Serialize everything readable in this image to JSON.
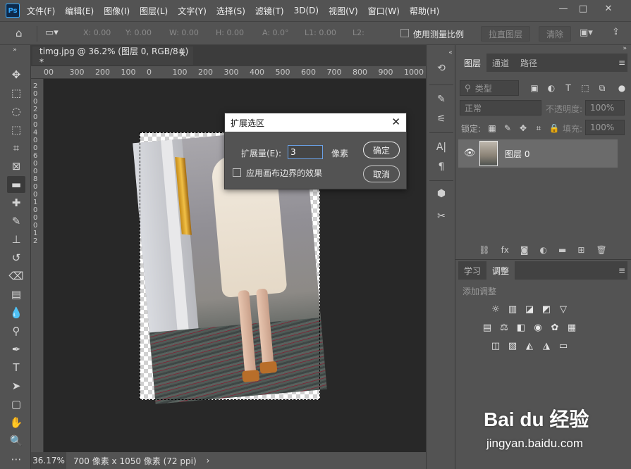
{
  "app": {
    "logo_text": "Ps"
  },
  "menu": [
    "文件(F)",
    "编辑(E)",
    "图像(I)",
    "图层(L)",
    "文字(Y)",
    "选择(S)",
    "滤镜(T)",
    "3D(D)",
    "视图(V)",
    "窗口(W)",
    "帮助(H)"
  ],
  "window_controls": {
    "minimize": "—",
    "maximize": "□",
    "close": "✕"
  },
  "options": {
    "x": "X: 0.00",
    "y": "Y: 0.00",
    "w": "W: 0.00",
    "h": "H: 0.00",
    "angle": "A: 0.0°",
    "l1": "L1: 0.00",
    "l2": "L2:",
    "use_scale_label": "使用测量比例",
    "straighten_label": "拉直图层",
    "clear_label": "清除"
  },
  "document": {
    "tab_title": "timg.jpg @ 36.2% (图层 0, RGB/8#) *",
    "ruler_h": [
      "00",
      "300",
      "200",
      "100",
      "0",
      "100",
      "200",
      "300",
      "400",
      "500",
      "600",
      "700",
      "800",
      "900",
      "1000"
    ],
    "ruler_v": [
      "2",
      "0",
      "0",
      "2",
      "0",
      "0",
      "4",
      "0",
      "0",
      "6",
      "0",
      "0",
      "8",
      "0",
      "0",
      "1",
      "0",
      "0",
      "0",
      "1",
      "2"
    ],
    "zoom": "36.17%",
    "size_info": "700 像素 x 1050 像素 (72 ppi)",
    "status_arrow": "›"
  },
  "dialog": {
    "title": "扩展选区",
    "expand_label": "扩展量(E):",
    "expand_value": "3",
    "unit": "像素",
    "ok_label": "确定",
    "cancel_label": "取消",
    "canvas_effect_label": "应用画布边界的效果"
  },
  "layers_panel": {
    "tabs": [
      "图层",
      "通道",
      "路径"
    ],
    "filter_placeholder": "类型",
    "blend_mode": "正常",
    "opacity_label": "不透明度:",
    "opacity_value": "100%",
    "lock_label": "锁定:",
    "fill_label": "填充:",
    "fill_value": "100%",
    "layer_name": "图层 0"
  },
  "adjustments_panel": {
    "tabs": [
      "学习",
      "调整"
    ],
    "title": "添加调整"
  },
  "watermark": {
    "logo": "Bai du 经验",
    "sub": "jingyan.baidu.com"
  }
}
